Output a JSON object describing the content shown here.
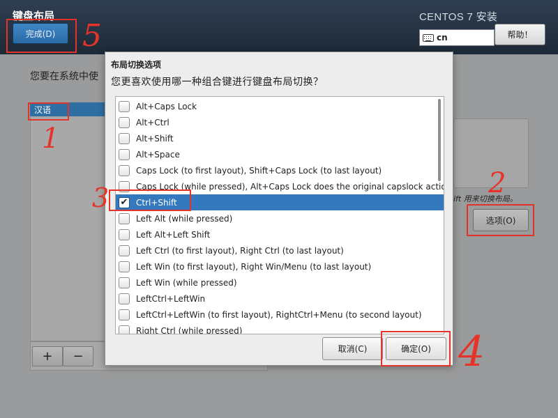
{
  "header": {
    "title": "键盘布局",
    "done_button": "完成(D)",
    "product": "CENTOS 7 安装",
    "keyboard_indicator": "cn",
    "help_button": "帮助！"
  },
  "background": {
    "intro_text": "您要在系统中使",
    "language_list_header": "汉语",
    "toolbar_add": "+",
    "toolbar_remove": "−",
    "hint_text": "ift 用来切换布局。",
    "options_button": "选项(O)"
  },
  "dialog": {
    "title": "布局切换选项",
    "question": "您更喜欢使用哪一种组合键进行键盘布局切换？",
    "options": [
      {
        "label": "Alt+Caps Lock",
        "checked": false
      },
      {
        "label": "Alt+Ctrl",
        "checked": false
      },
      {
        "label": "Alt+Shift",
        "checked": false
      },
      {
        "label": "Alt+Space",
        "checked": false
      },
      {
        "label": "Caps Lock (to first layout), Shift+Caps Lock (to last layout)",
        "checked": false
      },
      {
        "label": "Caps Lock (while pressed), Alt+Caps Lock does the original capslock action",
        "checked": false
      },
      {
        "label": "Ctrl+Shift",
        "checked": true
      },
      {
        "label": "Left Alt (while pressed)",
        "checked": false
      },
      {
        "label": "Left Alt+Left Shift",
        "checked": false
      },
      {
        "label": "Left Ctrl (to first layout), Right Ctrl (to last layout)",
        "checked": false
      },
      {
        "label": "Left Win (to first layout), Right Win/Menu (to last layout)",
        "checked": false
      },
      {
        "label": "Left Win (while pressed)",
        "checked": false
      },
      {
        "label": "LeftCtrl+LeftWin",
        "checked": false
      },
      {
        "label": "LeftCtrl+LeftWin (to first layout), RightCtrl+Menu (to second layout)",
        "checked": false
      },
      {
        "label": "Right Ctrl (while pressed)",
        "checked": false
      }
    ],
    "cancel_button": "取消(C)",
    "ok_button": "确定(O)"
  },
  "annotations": {
    "label_1": "1",
    "label_2": "2",
    "label_3": "3",
    "label_4": "4",
    "label_5": "5",
    "color": "#e6332a"
  }
}
